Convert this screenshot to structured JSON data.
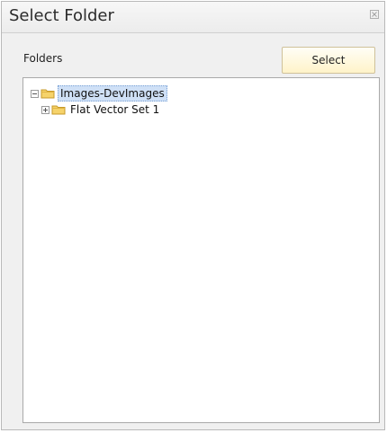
{
  "dialog": {
    "title": "Select Folder",
    "folders_label": "Folders",
    "select_button": "Select"
  },
  "tree": {
    "root": {
      "label": "Images-DevImages",
      "expanded": true,
      "selected": true
    },
    "children": [
      {
        "label": "Flat Vector Set 1",
        "expanded": false
      }
    ]
  },
  "colors": {
    "selection": "#cfe0f6",
    "select_button": "#fff3c9",
    "folder": "#f6d36a"
  }
}
